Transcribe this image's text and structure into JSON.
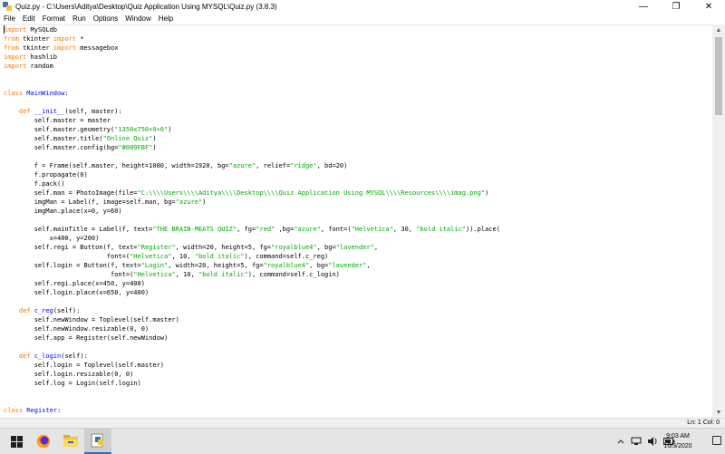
{
  "window": {
    "title": "Quiz.py - C:\\Users\\Aditya\\Desktop\\Quiz Application Using MYSQL\\Quiz.py (3.8.3)",
    "minimize": "—",
    "maximize": "❐",
    "close": "✕"
  },
  "menu": [
    "File",
    "Edit",
    "Format",
    "Run",
    "Options",
    "Window",
    "Help"
  ],
  "status": {
    "line_col": "Ln: 1   Col: 0"
  },
  "taskbar": {
    "icons": [
      "start-icon",
      "firefox-icon",
      "file-explorer-icon",
      "python-idle-icon"
    ],
    "time": "9:03 AM",
    "date": "10/3/2020"
  }
}
